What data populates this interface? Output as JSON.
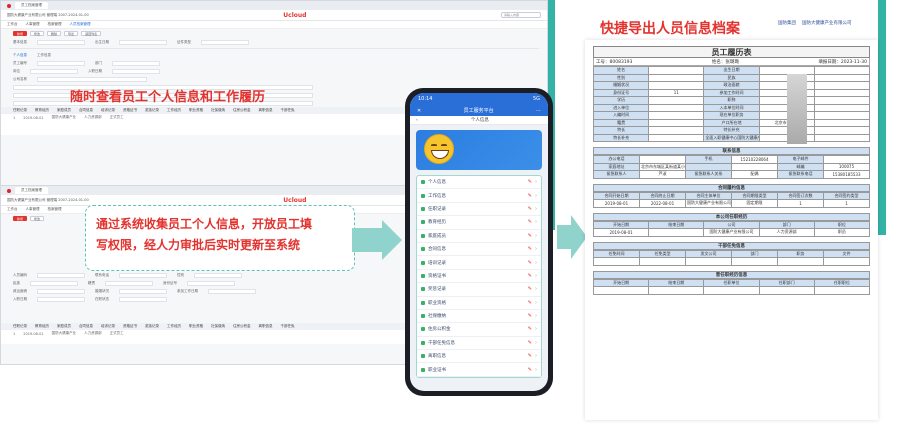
{
  "colors": {
    "accent": "#e2332f",
    "teal": "#32b3a6",
    "blue": "#2a6fd8",
    "table_head": "#cfe0f3"
  },
  "top_screen": {
    "tab": "员工档案管理",
    "company": "国防大健康产业有限公司 管理端 2007-2024-01-00",
    "logo": "Ucloud",
    "search": "请输入内容",
    "subtabs": [
      "工作台",
      "人事管理",
      "档案管理",
      "人员档案管理"
    ],
    "btns": [
      "新增",
      "修改",
      "删除",
      "导出",
      "返回列表"
    ],
    "fields": [
      "基本信息",
      "出生日期",
      "证件类型",
      "员工编号",
      "部门",
      "岗位",
      "入职日期",
      "公司名称"
    ],
    "section": [
      "个人信息",
      "工作信息"
    ],
    "grid_tabs": [
      "任职记录",
      "教育经历",
      "家庭成员",
      "合同信息",
      "培训记录",
      "资格证书",
      "奖惩记录",
      "工作经历",
      "职业资格",
      "社保缴纳",
      "住房公积金",
      "离职信息",
      "干部任免"
    ],
    "grid_row": [
      "1",
      "2019-08-01",
      "国防大健康产业",
      "人力资源部",
      "正式员工"
    ]
  },
  "top_callout": "随时查看员工个人信息和工作履历",
  "bottom_screen": {
    "tab": "员工档案管理",
    "company": "国防大健康产业有限公司 管理端 2007-2024-01-00",
    "logo": "Ucloud",
    "fields": [
      "人员编码",
      "联系电话",
      "性别",
      "民族",
      "籍贯",
      "身份证号",
      "政治面貌",
      "婚姻状况",
      "参加工作日期",
      "入职日期",
      "在职状态"
    ],
    "grid_tabs": [
      "任职记录",
      "教育经历",
      "家庭成员",
      "合同信息",
      "培训记录",
      "资格证书",
      "奖惩记录",
      "工作经历",
      "职业资格",
      "社保缴纳",
      "住房公积金",
      "离职信息",
      "干部任免"
    ],
    "grid_row": [
      "1",
      "2019-08-01",
      "国防大健康产业",
      "人力资源部",
      "正式员工"
    ]
  },
  "bubble": [
    "通过系统收集员工个人信息，开放员工填",
    "写权限，经人力审批后实时更新至系统"
  ],
  "phone": {
    "time": "10:14",
    "status": "5G",
    "app_title": "员工服务平台",
    "sub_title": "个人信息",
    "items": [
      "个人信息",
      "工作信息",
      "任职记录",
      "教育经历",
      "家庭成员",
      "合同信息",
      "培训记录",
      "资格证书",
      "奖惩记录",
      "职业资格",
      "社保缴纳",
      "住房公积金",
      "干部任免信息",
      "离职信息",
      "职业证书"
    ]
  },
  "resume": {
    "headline": "快捷导出人员信息档案",
    "logo1": "国防集团",
    "logo2": "国防大健康产业有限公司",
    "title": "员工履历表",
    "meta": [
      "工号：",
      "80083193",
      "姓名：",
      "张璐璐",
      "填报日期：",
      "2023-11-30"
    ],
    "basic": [
      [
        "姓名",
        "",
        "出生日期",
        ""
      ],
      [
        "性别",
        "",
        "民族",
        ""
      ],
      [
        "婚姻状况",
        "",
        "政治面貌",
        ""
      ],
      [
        "身份证号",
        "11",
        "参加工作时间",
        ""
      ],
      [
        "学历",
        "",
        "职称",
        ""
      ],
      [
        "进入单位",
        "",
        "入本单位时间",
        ""
      ],
      [
        "入编时间",
        "",
        "现在单位职务",
        ""
      ],
      [
        "籍贯",
        "",
        "户口所在地",
        "北京市东城区"
      ],
      [
        "特长",
        "",
        "特长补充",
        ""
      ],
      [
        "特长补充",
        "",
        "全面入职健康中心国防大健康产业有限公司",
        ""
      ]
    ],
    "contact_title": "联系信息",
    "contact": [
      [
        "办公电话",
        "",
        "手机",
        "15210228064",
        "电子邮件",
        ""
      ],
      [
        "家庭地址",
        "北京市东城区某街道某小区",
        "",
        "",
        "邮编",
        "100075"
      ],
      [
        "紧急联系人",
        "芦淑",
        "紧急联系人关系",
        "配偶",
        "紧急联系电话",
        "15380185533"
      ]
    ],
    "contract_title": "合同履约信息",
    "contract_head": [
      "合同开始日期",
      "合同终止日期",
      "合同主体单位",
      "合同期限类型",
      "合同签订次数",
      "合同签约类型"
    ],
    "contract_row": [
      "2019-08-01",
      "2022-08-01",
      "国防大健康产业有限公司",
      "固定期限",
      "1",
      "1"
    ],
    "job_title": "本公司任职经历",
    "job_head": [
      "开始日期",
      "结束日期",
      "公司",
      "部门",
      "职位"
    ],
    "job_row": [
      "2019-08-01",
      "",
      "国防大健康产业有限公司",
      "人力资源部",
      "职员"
    ],
    "cadre_title": "干部任免信息",
    "cadre_head": [
      "任免时间",
      "任免类型",
      "发文公司",
      "部门",
      "职务",
      "文件"
    ],
    "prev_title": "曾任职经历信息",
    "prev_head": [
      "开始日期",
      "结束日期",
      "任职单位",
      "任职部门",
      "任职职位"
    ]
  }
}
